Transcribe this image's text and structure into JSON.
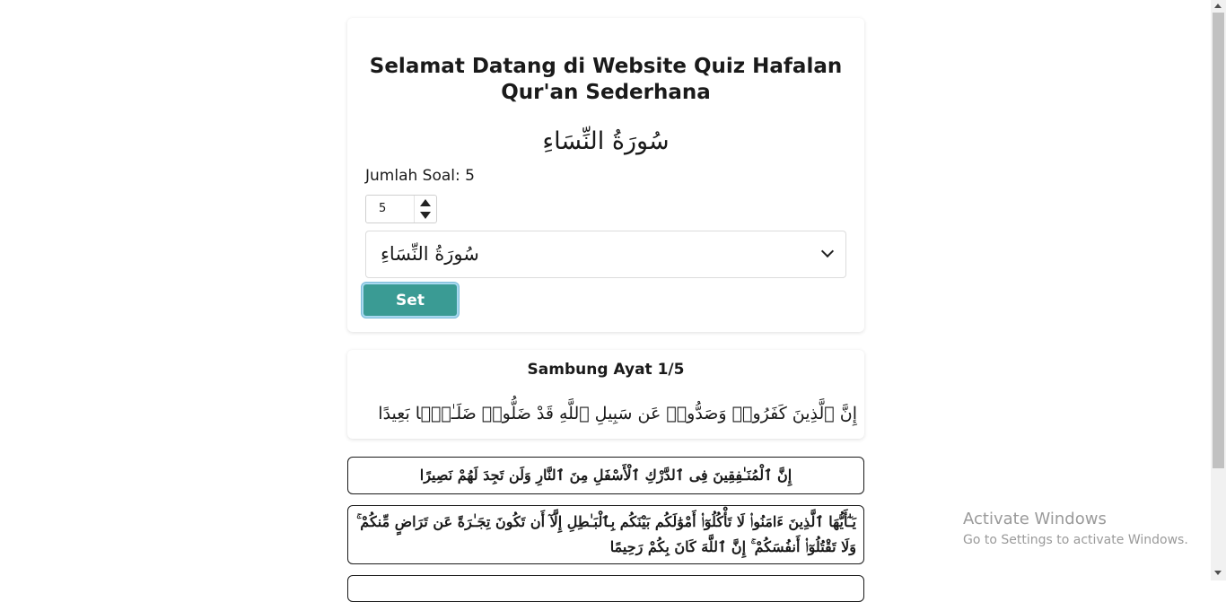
{
  "header": {
    "title_line1": "Selamat Datang di Website Quiz Hafalan",
    "title_line2": "Qur'an Sederhana"
  },
  "setup": {
    "surah_heading": "سُورَةُ النِّسَاءِ",
    "question_count_label": "Jumlah Soal: 5",
    "question_count_value": "5",
    "surah_select_value": "سُورَةُ النِّسَاءِ",
    "set_button_label": "Set"
  },
  "quiz": {
    "title": "Sambung Ayat 1/5",
    "ayah": "إِنَّ ٱلَّذِينَ كَفَرُوا۟ وَصَدُّوا۟ عَن سَبِيلِ ٱللَّهِ قَدْ ضَلُّوا۟ ضَلَـٰلًۢا بَعِيدًا",
    "options": [
      "إِنَّ ٱلْمُنَـٰفِقِينَ فِى ٱلدَّرْكِ ٱلْأَسْفَلِ مِنَ ٱلنَّارِ وَلَن تَجِدَ لَهُمْ نَصِيرًا",
      "يَـٰٓأَيُّهَا ٱلَّذِينَ ءَامَنُوا۟ لَا تَأْكُلُوٓا۟ أَمْوَٰلَكُم بَيْنَكُم بِٱلْبَـٰطِلِ إِلَّآ أَن تَكُونَ تِجَـٰرَةً عَن تَرَاضٍ مِّنكُمْ ۚ وَلَا تَقْتُلُوٓا۟ أَنفُسَكُمْ ۚ إِنَّ ٱللَّهَ كَانَ بِكُمْ رَحِيمًا",
      ""
    ]
  },
  "watermark": {
    "line1": "Activate Windows",
    "line2": "Go to Settings to activate Windows."
  },
  "colors": {
    "accent": "#3a9b94",
    "border": "#1a1a1a"
  }
}
